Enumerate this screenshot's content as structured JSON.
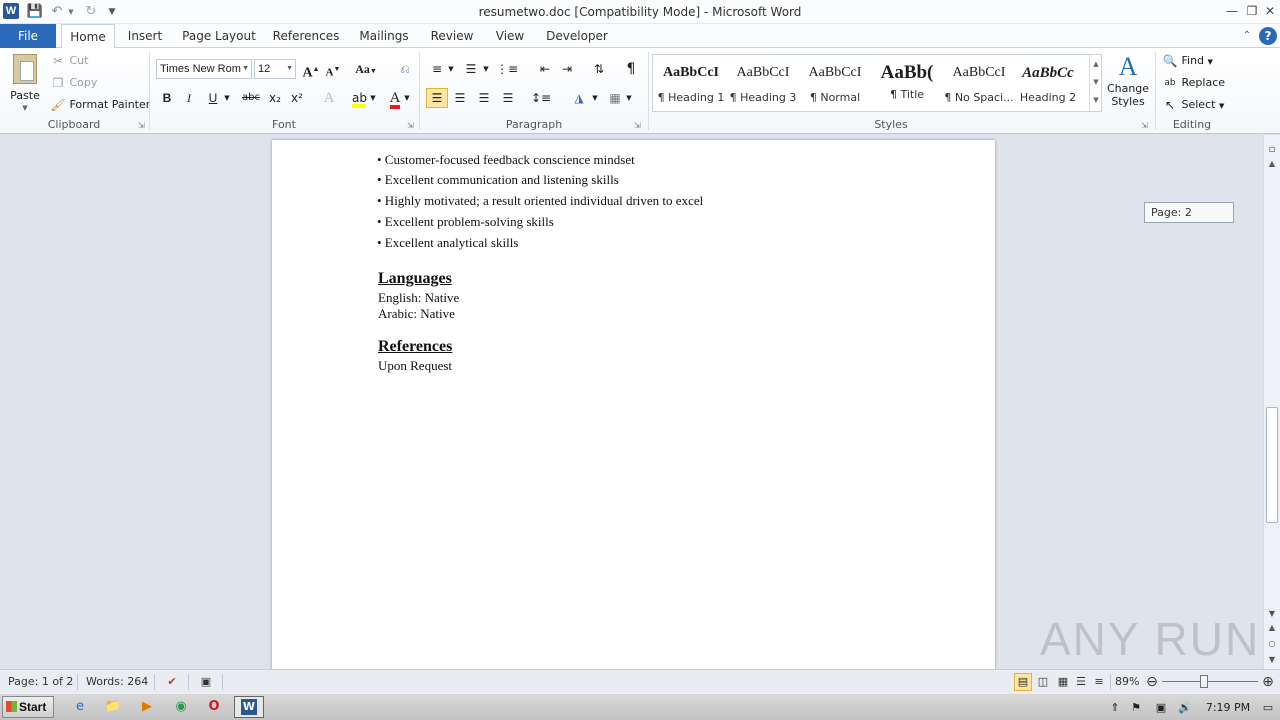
{
  "window": {
    "title": "resumetwo.doc [Compatibility Mode]  -  Microsoft Word",
    "app_icon": "W"
  },
  "qat": {
    "save_icon": "save-icon",
    "undo_icon": "undo-icon",
    "redo_icon": "redo-icon"
  },
  "tabs": {
    "file": "File",
    "items": [
      "Home",
      "Insert",
      "Page Layout",
      "References",
      "Mailings",
      "Review",
      "View",
      "Developer"
    ],
    "active": "Home"
  },
  "clipboard": {
    "paste": "Paste",
    "cut": "Cut",
    "copy": "Copy",
    "format_painter": "Format Painter",
    "label": "Clipboard"
  },
  "font": {
    "name": "Times New Rom",
    "size": "12",
    "label": "Font",
    "bold": "B",
    "italic": "I",
    "underline": "U",
    "strike": "abc",
    "subscript": "x₂",
    "superscript": "x²",
    "grow": "A",
    "shrink": "A",
    "case": "Aa"
  },
  "paragraph": {
    "label": "Paragraph",
    "pilcrow": "¶"
  },
  "styles": {
    "label": "Styles",
    "items": [
      {
        "preview": "AaBbCcI",
        "name": "¶ Heading 1"
      },
      {
        "preview": "AaBbCcI",
        "name": "¶ Heading 3"
      },
      {
        "preview": "AaBbCcI",
        "name": "¶ Normal"
      },
      {
        "preview": "AaBb(",
        "name": "¶ Title"
      },
      {
        "preview": "AaBbCcI",
        "name": "¶ No Spaci..."
      },
      {
        "preview": "AaBbCc",
        "name": "Heading 2"
      }
    ],
    "change_styles": "Change Styles"
  },
  "editing": {
    "label": "Editing",
    "find": "Find",
    "replace": "Replace",
    "select": "Select"
  },
  "document": {
    "bullets": [
      "• Customer-focused feedback conscience mindset",
      "• Excellent  communication and listening  skills",
      "• Highly  motivated; a result oriented individual  driven to excel",
      "• Excellent  problem-solving  skills",
      "• Excellent  analytical  skills"
    ],
    "languages_heading": "Languages",
    "languages": [
      "English:  Native",
      "Arabic:  Native"
    ],
    "references_heading": "References",
    "references_text": "Upon Request"
  },
  "page_tip": "Page: 2",
  "status": {
    "page": "Page: 1 of 2",
    "words": "Words: 264",
    "zoom": "89%"
  },
  "taskbar": {
    "start": "Start",
    "time": "7:19 PM"
  },
  "watermark": "ANY RUN"
}
